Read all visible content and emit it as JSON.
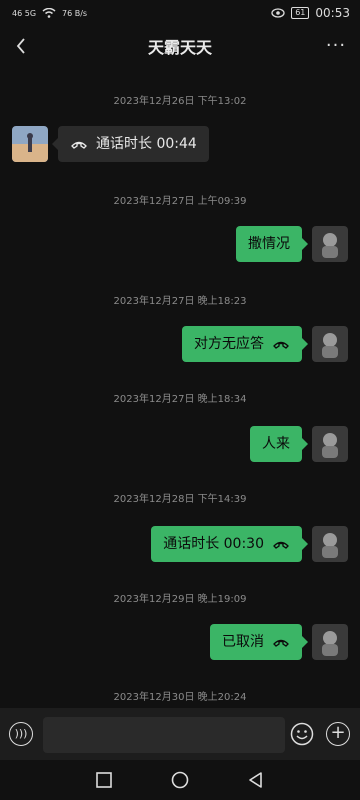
{
  "status_bar": {
    "left_text": "46 5G",
    "net_speed": "76 B/s",
    "battery": "61",
    "time": "00:53"
  },
  "header": {
    "title": "天霸天天",
    "more_label": "···"
  },
  "messages": [
    {
      "timestamp": "2023年12月26日 下午13:02",
      "side": "left",
      "text": "通话时长 00:44",
      "icon": "phone-icon"
    },
    {
      "timestamp": "2023年12月27日 上午09:39",
      "side": "right",
      "text": "撒情况",
      "icon": ""
    },
    {
      "timestamp": "2023年12月27日 晚上18:23",
      "side": "right",
      "text": "对方无应答",
      "icon": "phone-icon"
    },
    {
      "timestamp": "2023年12月27日 晚上18:34",
      "side": "right",
      "text": "人来",
      "icon": ""
    },
    {
      "timestamp": "2023年12月28日 下午14:39",
      "side": "right",
      "text": "通话时长 00:30",
      "icon": "phone-icon"
    },
    {
      "timestamp": "2023年12月29日 晚上19:09",
      "side": "right",
      "text": "已取消",
      "icon": "phone-icon"
    },
    {
      "timestamp": "2023年12月30日 晚上20:24",
      "side": "",
      "text": "",
      "icon": ""
    }
  ],
  "input_bar": {
    "placeholder": "",
    "voice_icon": "voice-icon",
    "emoji_icon": "emoji-icon",
    "plus_icon": "plus-icon"
  },
  "colors": {
    "background": "#111111",
    "outgoing_bubble": "#3bb566",
    "incoming_bubble": "#2b2b2b"
  }
}
